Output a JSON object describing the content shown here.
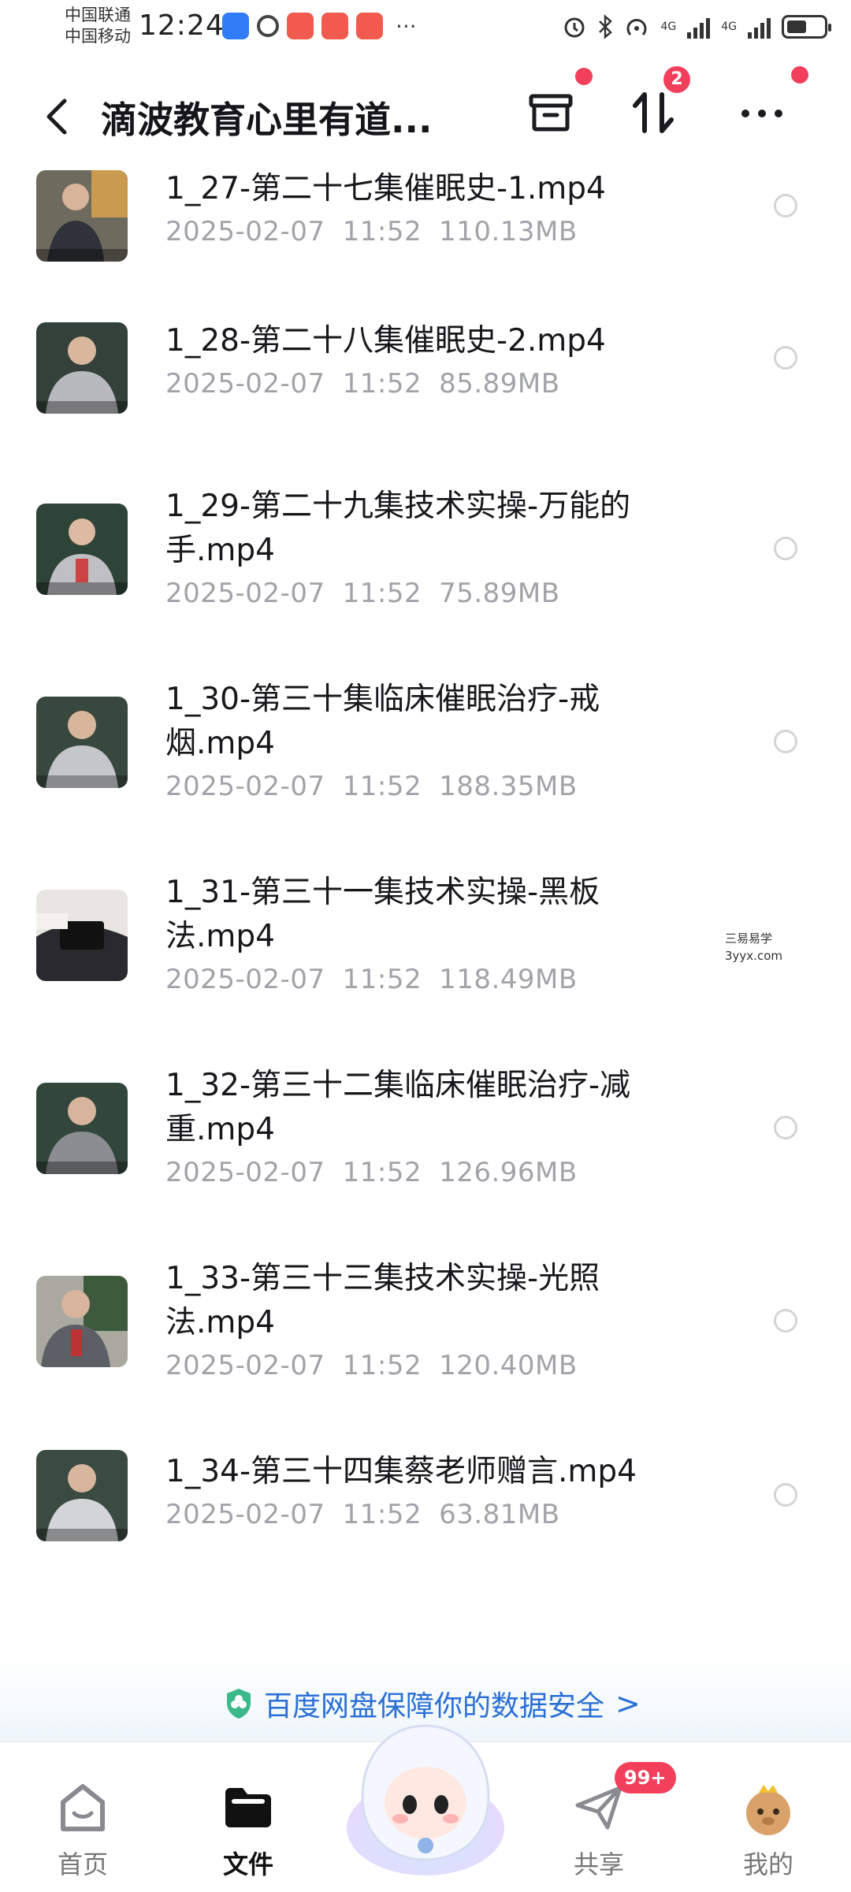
{
  "status_bar": {
    "carrier_1": "中国联通",
    "carrier_2": "中国移动",
    "time": "12:24",
    "network_1": "4G",
    "network_2": "4G",
    "more": "···"
  },
  "header": {
    "back_icon": "chevron-left-icon",
    "title": "滴波教育心里有道...",
    "transfer_badge": "2",
    "accent_color": "#f23f5c"
  },
  "files": [
    {
      "name": "1_27-第二十七集催眠史-1.mp4",
      "date": "2025-02-07",
      "time": "11:52",
      "size": "110.13MB"
    },
    {
      "name": "1_28-第二十八集催眠史-2.mp4",
      "date": "2025-02-07",
      "time": "11:52",
      "size": "85.89MB"
    },
    {
      "name": "1_29-第二十九集技术实操-万能的手.mp4",
      "date": "2025-02-07",
      "time": "11:52",
      "size": "75.89MB"
    },
    {
      "name": "1_30-第三十集临床催眠治疗-戒烟.mp4",
      "date": "2025-02-07",
      "time": "11:52",
      "size": "188.35MB"
    },
    {
      "name": "1_31-第三十一集技术实操-黑板法.mp4",
      "date": "2025-02-07",
      "time": "11:52",
      "size": "118.49MB"
    },
    {
      "name": "1_32-第三十二集临床催眠治疗-减重.mp4",
      "date": "2025-02-07",
      "time": "11:52",
      "size": "126.96MB"
    },
    {
      "name": "1_33-第三十三集技术实操-光照法.mp4",
      "date": "2025-02-07",
      "time": "11:52",
      "size": "120.40MB"
    },
    {
      "name": "1_34-第三十四集蔡老师赠言.mp4",
      "date": "2025-02-07",
      "time": "11:52",
      "size": "63.81MB"
    }
  ],
  "watermark": {
    "line1": "三易易学",
    "line2": "3yyx.com"
  },
  "security_banner": {
    "text": "百度网盘保障你的数据安全",
    "arrow": ">"
  },
  "bottom_nav": {
    "home": "首页",
    "files": "文件",
    "share": "共享",
    "share_badge": "99+",
    "mine": "我的"
  }
}
